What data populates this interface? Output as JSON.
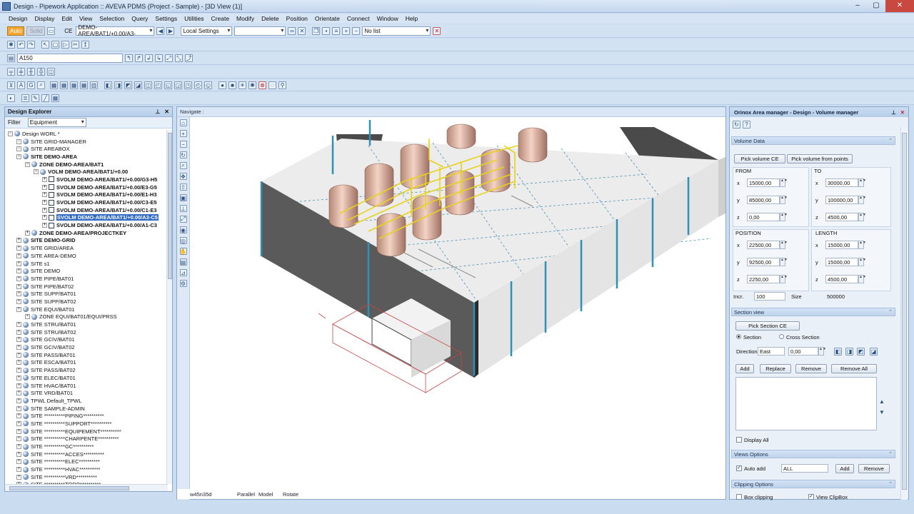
{
  "window": {
    "title": "Design - Pipework Application :: AVEVA PDMS (Project - Sample) - [3D View (1)]"
  },
  "menu": [
    "Design",
    "Display",
    "Edit",
    "View",
    "Selection",
    "Query",
    "Settings",
    "Utilities",
    "Create",
    "Modify",
    "Delete",
    "Position",
    "Orientate",
    "Connect",
    "Window",
    "Help"
  ],
  "toolbar1": {
    "auto": "Auto",
    "solid": "Solid",
    "ce_label": "CE",
    "ce_value": "DEMO-AREA/BAT1/+0.00/A3-",
    "local_settings": "Local Settings",
    "list": "No list"
  },
  "toolbar3": {
    "field": "A150"
  },
  "explorer": {
    "title": "Design Explorer",
    "filter_label": "Filter",
    "filter_value": "Equipment",
    "nodes": [
      {
        "d": 0,
        "t": "Design WORL *",
        "b": false
      },
      {
        "d": 1,
        "t": "SITE GRID-MANAGER",
        "b": false
      },
      {
        "d": 1,
        "t": "SITE AREABOX",
        "b": false
      },
      {
        "d": 1,
        "t": "SITE DEMO-AREA",
        "b": true
      },
      {
        "d": 2,
        "t": "ZONE DEMO-AREA/BAT1",
        "b": true
      },
      {
        "d": 3,
        "t": "VOLM DEMO-AREA/BAT1/+0.00",
        "b": true
      },
      {
        "d": 4,
        "t": "SVOLM DEMO-AREA/BAT1/+0.00/G3-H5",
        "b": true
      },
      {
        "d": 4,
        "t": "SVOLM DEMO-AREA/BAT1/+0.00/E3-G5",
        "b": true
      },
      {
        "d": 4,
        "t": "SVOLM DEMO-AREA/BAT1/+0.00/E1-H3",
        "b": true
      },
      {
        "d": 4,
        "t": "SVOLM DEMO-AREA/BAT1/+0.00/C3-E5",
        "b": true
      },
      {
        "d": 4,
        "t": "SVOLM DEMO-AREA/BAT1/+0.00/C1-E3",
        "b": true
      },
      {
        "d": 4,
        "t": "SVOLM DEMO-AREA/BAT1/+0.00/A3-C5",
        "b": true,
        "sel": true
      },
      {
        "d": 4,
        "t": "SVOLM DEMO-AREA/BAT1/+0.00/A1-C3",
        "b": true
      },
      {
        "d": 2,
        "t": "ZONE DEMO-AREA/PROJECTKEY",
        "b": true
      },
      {
        "d": 1,
        "t": "SITE DEMO-GRID",
        "b": true
      },
      {
        "d": 1,
        "t": "SITE GRID/AREA",
        "b": false
      },
      {
        "d": 1,
        "t": "SITE AREA-DEMO",
        "b": false
      },
      {
        "d": 1,
        "t": "SITE s1",
        "b": false
      },
      {
        "d": 1,
        "t": "SITE DEMO",
        "b": false
      },
      {
        "d": 1,
        "t": "SITE PIPE/BAT01",
        "b": false
      },
      {
        "d": 1,
        "t": "SITE PIPE/BAT02",
        "b": false
      },
      {
        "d": 1,
        "t": "SITE SUPP/BAT01",
        "b": false
      },
      {
        "d": 1,
        "t": "SITE SUPP/BAT02",
        "b": false
      },
      {
        "d": 1,
        "t": "SITE EQUI/BAT01",
        "b": false
      },
      {
        "d": 2,
        "t": "ZONE EQUI/BAT01/EQUI/PRSS",
        "b": false
      },
      {
        "d": 1,
        "t": "SITE STRU/BAT01",
        "b": false
      },
      {
        "d": 1,
        "t": "SITE STRU/BAT02",
        "b": false
      },
      {
        "d": 1,
        "t": "SITE GCIV/BAT01",
        "b": false
      },
      {
        "d": 1,
        "t": "SITE GCIV/BAT02",
        "b": false
      },
      {
        "d": 1,
        "t": "SITE PASS/BAT01",
        "b": false
      },
      {
        "d": 1,
        "t": "SITE ESCA/BAT01",
        "b": false
      },
      {
        "d": 1,
        "t": "SITE PASS/BAT02",
        "b": false
      },
      {
        "d": 1,
        "t": "SITE ELEC/BAT01",
        "b": false
      },
      {
        "d": 1,
        "t": "SITE HVAC/BAT01",
        "b": false
      },
      {
        "d": 1,
        "t": "SITE VRD/BAT01",
        "b": false
      },
      {
        "d": 1,
        "t": "TPWL Default_TPWL",
        "b": false
      },
      {
        "d": 1,
        "t": "SITE SAMPLE-ADMIN",
        "b": false
      },
      {
        "d": 1,
        "t": "SITE **********PIPING**********",
        "b": false
      },
      {
        "d": 1,
        "t": "SITE **********SUPPORT**********",
        "b": false
      },
      {
        "d": 1,
        "t": "SITE **********EQUIPEMENT**********",
        "b": false
      },
      {
        "d": 1,
        "t": "SITE **********CHARPENTE**********",
        "b": false
      },
      {
        "d": 1,
        "t": "SITE **********GC**********",
        "b": false
      },
      {
        "d": 1,
        "t": "SITE **********ACCES**********",
        "b": false
      },
      {
        "d": 1,
        "t": "SITE **********ELEC**********",
        "b": false
      },
      {
        "d": 1,
        "t": "SITE **********HVAC**********",
        "b": false
      },
      {
        "d": 1,
        "t": "SITE **********VRD**********",
        "b": false
      },
      {
        "d": 1,
        "t": "SITE **********TOPO**********",
        "b": false
      }
    ]
  },
  "view": {
    "header": "Navigate :",
    "status": [
      "w45n35d",
      "Parallel",
      "Model",
      "Rotate"
    ]
  },
  "panel": {
    "title": "Orinox Area manager - Design - Volume manager",
    "volume_data": "Volume Data",
    "pick_volume": "Pick volume CE",
    "pick_points": "Pick volume from points",
    "from": "FROM",
    "to": "TO",
    "position": "POSITION",
    "length": "LENGTH",
    "from_vals": [
      "15000,00",
      "85000,00",
      "0,00"
    ],
    "to_vals": [
      "30000,00",
      "100000,00",
      "4500,00"
    ],
    "pos_vals": [
      "22500,00",
      "92500,00",
      "2250,00"
    ],
    "len_vals": [
      "15000,00",
      "15000,00",
      "4500,00"
    ],
    "axes": [
      "x",
      "y",
      "z"
    ],
    "incr_label": "Incr.",
    "incr_value": "100",
    "size_label": "Size",
    "size_value": "500000",
    "section_view": "Section view",
    "pick_section": "Pick Section CE",
    "section": "Section",
    "cross_section": "Cross Section",
    "direction_label": "Direction",
    "direction_value": "East",
    "direction_offset": "0,00",
    "add": "Add",
    "replace": "Replace",
    "remove": "Remove",
    "remove_all": "Remove All",
    "display_all": "Display All",
    "views_options": "Views Options",
    "auto_add": "Auto add",
    "all": "ALL",
    "add2": "Add",
    "remove2": "Remove",
    "clipping_options": "Clipping Options",
    "box_clipping": "Box clipping",
    "view_clipbox": "View ClipBox"
  }
}
